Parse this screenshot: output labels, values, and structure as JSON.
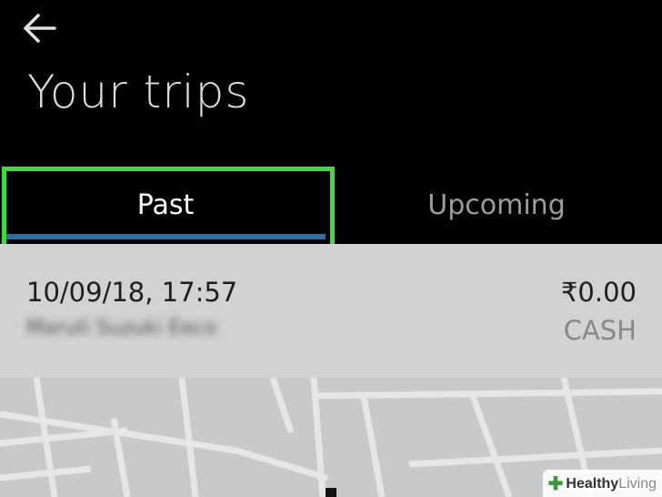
{
  "header": {
    "back_icon": "arrow-left-icon",
    "title": "Your trips"
  },
  "tabs": [
    {
      "label": "Past",
      "selected": true
    },
    {
      "label": "Upcoming",
      "selected": false
    }
  ],
  "trip": {
    "datetime": "10/09/18, 17:57",
    "vehicle": "Maruti Suzuki Eeco",
    "fare": "₹0.00",
    "payment": "CASH"
  },
  "watermark": {
    "brand": "Healthy",
    "suffix": "Living"
  },
  "colors": {
    "highlight": "#3cdc3c",
    "tab_underline": "#2f6da3"
  }
}
